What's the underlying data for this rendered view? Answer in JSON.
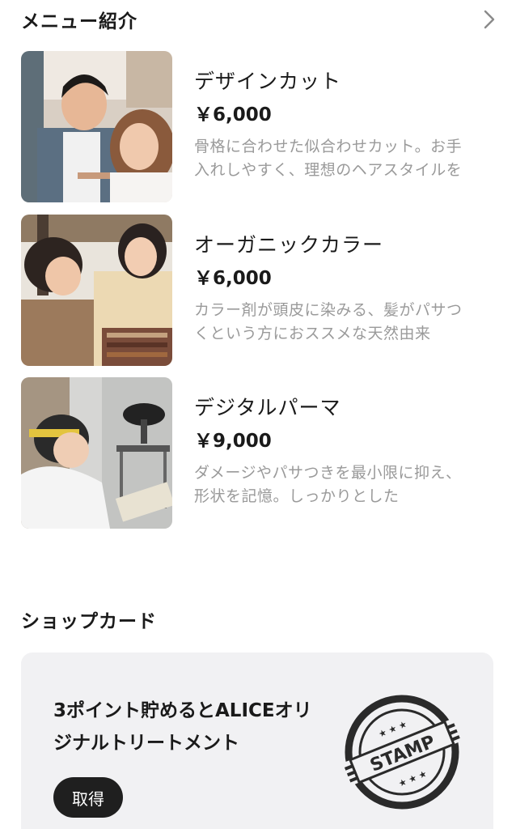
{
  "menu_section": {
    "title": "メニュー紹介",
    "more_icon": "chevron-right-icon"
  },
  "menu_items": [
    {
      "name": "デザインカット",
      "price": "￥6,000",
      "description": "骨格に合わせた似合わせカット。お手入れしやすく、理想のヘアスタイルを"
    },
    {
      "name": "オーガニックカラー",
      "price": "￥6,000",
      "description": "カラー剤が頭皮に染みる、髪がパサつくという方におススメな天然由来"
    },
    {
      "name": "デジタルパーマ",
      "price": "￥9,000",
      "description": "ダメージやパサつきを最小限に抑え、形状を記憶。しっかりとした"
    }
  ],
  "shop_card": {
    "title": "ショップカード",
    "text": "3ポイント貯めるとALICEオリジナルトリートメント",
    "button_label": "取得",
    "stamp_text": "STAMP",
    "stamp_icon": "stamp-icon"
  },
  "colors": {
    "text": "#1a1a1a",
    "muted": "#9a9a9a",
    "card_bg": "#f1f1f3",
    "button_bg": "#1f1f1f"
  }
}
